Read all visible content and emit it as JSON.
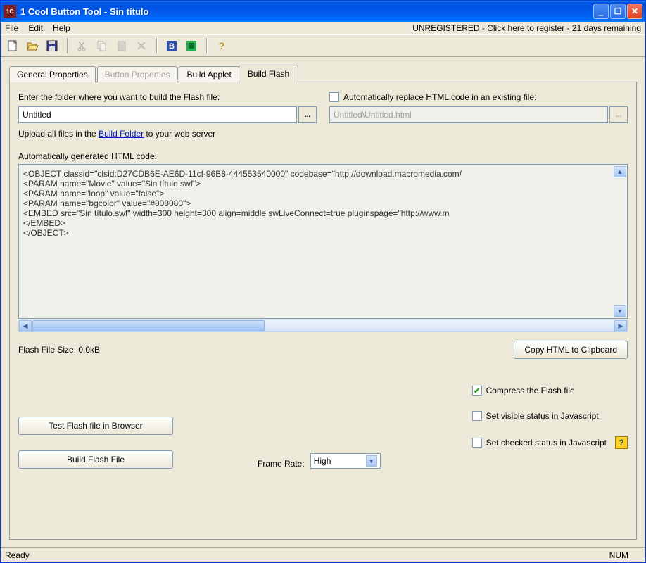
{
  "title": "1 Cool Button Tool - Sin título",
  "menu": {
    "file": "File",
    "edit": "Edit",
    "help": "Help",
    "register": "UNREGISTERED - Click here to register - 21 days remaining"
  },
  "tabs": {
    "general": "General Properties",
    "button": "Button Properties",
    "applet": "Build Applet",
    "flash": "Build Flash"
  },
  "flash": {
    "folder_label": "Enter the folder where you want to build the Flash file:",
    "folder_value": "Untitled",
    "auto_replace_label": "Automatically replace HTML code in an existing file:",
    "existing_placeholder": "Untitled\\Untitled.html",
    "upload_pre": "Upload all files in the ",
    "upload_link": "Build Folder",
    "upload_post": " to your web server",
    "code_label": "Automatically generated HTML code:",
    "code": "<OBJECT classid=\"clsid:D27CDB6E-AE6D-11cf-96B8-444553540000\" codebase=\"http://download.macromedia.com/\n<PARAM name=\"Movie\" value=\"Sin título.swf\">\n<PARAM name=\"loop\" value=\"false\">\n<PARAM name=\"bgcolor\" value=\"#808080\">\n<EMBED src=\"Sin título.swf\" width=300 height=300 align=middle swLiveConnect=true pluginspage=\"http://www.m\n</EMBED>\n</OBJECT>",
    "file_size_label": "Flash File Size: ",
    "file_size_value": "0.0kB",
    "copy_btn": "Copy HTML to Clipboard",
    "compress_label": "Compress the Flash file",
    "test_btn": "Test Flash file in Browser",
    "visible_label": "Set visible status in Javascript",
    "build_btn": "Build Flash File",
    "frame_rate_label": "Frame Rate:",
    "frame_rate_value": "High",
    "checked_label": "Set checked status in Javascript"
  },
  "status": {
    "ready": "Ready",
    "num": "NUM"
  }
}
